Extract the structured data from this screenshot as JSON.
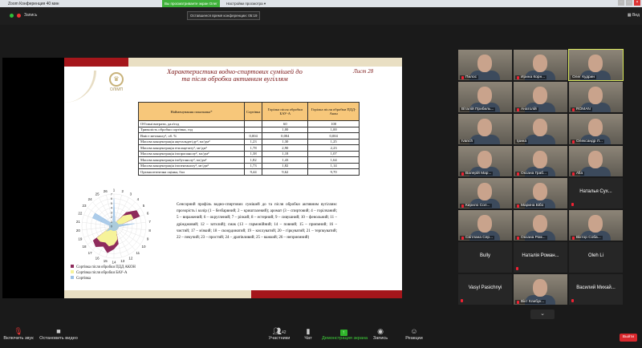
{
  "window": {
    "title": "Zoom Конференция 40 мин",
    "viewing_banner": "Вы просматриваете экран Олег Кудрин",
    "view_options": "Настройки просмотра ▾"
  },
  "meeting_bar": {
    "recording": "Запись",
    "timer": "Оставшееся время конференции: 05:19",
    "view": "Вид"
  },
  "slide": {
    "title_line1": "Характеристика водно-спиртових сумішей до",
    "title_line2": "та після обробки активним вугіллям",
    "sheet": "Лист 28",
    "logo_text": "ОЛІМП",
    "table": {
      "headers": [
        "Найменування показника*",
        "Сортівка",
        "Горілка після обробки БАУ-А",
        "Горілка після обробки ПДД-Акон"
      ],
      "rows": [
        [
          "Об'ємні витрати, дал/год",
          "",
          "60",
          "100"
        ],
        [
          "Тривалість обробки сортівки, год",
          "",
          "1,00",
          "1,00"
        ],
        [
          "Вміст метанолу¹, об. %",
          "0,004",
          "0,004",
          "0,004"
        ],
        [
          "Масова концентрація ацетальдегіду², мг/дм³",
          "1,23",
          "1,30",
          "1,25"
        ],
        [
          "Масова концентрація етилацетату², мг/дм³",
          "1,78",
          "2,90",
          "2,23"
        ],
        [
          "Масова концентрація ізопропанолу², мг/дм³",
          "1,38",
          "1,18",
          "1,07"
        ],
        [
          "Масова концентрація ізобутанолу², мг/дм³",
          "1,82",
          "1,43",
          "1,64"
        ],
        [
          "Масова концентрація ізопентанолу², мг/дм³",
          "1,73",
          "1,82",
          "1,14"
        ],
        [
          "Органолептична оцінка, бал",
          "9,44",
          "9,62",
          "9,70"
        ]
      ]
    },
    "description": "Сенсорний профіль водно-спиртових сумішей до та після обробки активним вугіллям: прозорість і колір (1 – безбарвний; 2 – кришталевий); аромат (3 – спиртовий; 4 – горілчаний; 5 – виражений; 6 – округлений; 7 – різкий; 8 – естерний; 9 – сивушний; 10 – фенольний; 11 – дріжджовий; 12 – затхлий); смак (13 – гармонійний; 14 – повний; 15 – приємний; 16 – чистий; 17 – м'який; 18 – скоординатий; 19 – кислуватий; 20 – гіркуватий; 21 – терпкуватий; 22 – пекучий; 23 – простий; 24 – дратівливий; 25 – важкий; 26 – неприємний)",
    "radar": {
      "axes": [
        "1",
        "2",
        "3",
        "4",
        "5",
        "6",
        "7",
        "8",
        "9",
        "10",
        "11",
        "12",
        "13",
        "14",
        "15",
        "16",
        "17",
        "18",
        "19",
        "20",
        "21",
        "22",
        "23",
        "24",
        "25",
        "26"
      ],
      "scale_labels": [
        "0",
        "1",
        "2",
        "3",
        "4",
        "5",
        "6",
        "7"
      ],
      "max": 7,
      "series": [
        {
          "name": "Сортівка після обробки ПДД АКОН",
          "color": "#8e2b5c",
          "values": [
            1,
            1,
            1,
            4,
            6,
            6,
            1,
            1,
            1,
            1,
            1,
            1,
            4,
            5,
            6,
            5,
            6,
            5.5,
            1,
            1,
            1,
            1,
            1,
            1,
            1,
            1
          ]
        },
        {
          "name": "Сортівка після обробки БАУ-А",
          "color": "#f6f39a",
          "values": [
            1,
            1,
            1,
            3,
            4.5,
            4.5,
            1,
            1,
            1,
            1,
            1,
            1,
            3,
            4,
            4.5,
            4,
            4.5,
            4.5,
            1,
            1,
            1,
            1,
            1,
            1,
            1,
            1
          ]
        },
        {
          "name": "Сортівка",
          "color": "#9ec3e6",
          "values": [
            6,
            1,
            1,
            1,
            1,
            1,
            4.5,
            1,
            1,
            1,
            1,
            1,
            1,
            1,
            1,
            1,
            1,
            2,
            1,
            1,
            1,
            5,
            5,
            1,
            1,
            1
          ]
        }
      ]
    }
  },
  "participants": [
    {
      "name": "Пилос",
      "type": "video",
      "muted": true
    },
    {
      "name": "Ирина Корн...",
      "type": "video",
      "muted": true
    },
    {
      "name": "Олег Кудрин",
      "type": "video",
      "muted": false,
      "active": true
    },
    {
      "name": "Віталій Прибиль...",
      "type": "video",
      "muted": false
    },
    {
      "name": "Анатолій",
      "type": "video",
      "muted": true
    },
    {
      "name": "ROMAN",
      "type": "video",
      "muted": true
    },
    {
      "name": "Ivanch",
      "type": "video",
      "muted": false
    },
    {
      "name": "Ірина",
      "type": "video",
      "muted": false
    },
    {
      "name": "Олександр Л...",
      "type": "video",
      "muted": true
    },
    {
      "name": "Валерій Мар...",
      "type": "video",
      "muted": true
    },
    {
      "name": "Оксана Граб...",
      "type": "video",
      "muted": true
    },
    {
      "name": "Alla",
      "type": "video",
      "muted": true
    },
    {
      "name": "Кирило Сол...",
      "type": "video",
      "muted": true
    },
    {
      "name": "Марина Бібо",
      "type": "video",
      "muted": true
    },
    {
      "name": "Наталья Сух...",
      "type": "dark",
      "muted": true
    },
    {
      "name": "Світлана Сер...",
      "type": "video",
      "muted": true
    },
    {
      "name": "Оксана Ром...",
      "type": "video",
      "muted": true
    },
    {
      "name": "Віктор Соба...",
      "type": "video",
      "muted": true
    },
    {
      "name": "Bully",
      "type": "name",
      "muted": false
    },
    {
      "name": "Наталія Роман...",
      "type": "name",
      "muted": true
    },
    {
      "name": "Oleh Li",
      "type": "name",
      "muted": false
    },
    {
      "name": "Vasyl Pasichnyi",
      "type": "name",
      "muted": true
    },
    {
      "name": "Вікт Клибук...",
      "type": "video",
      "muted": true
    },
    {
      "name": "Василий Михай...",
      "type": "name",
      "muted": true
    }
  ],
  "toolbar": {
    "unmute": "Включить звук",
    "stop_video": "Остановить видео",
    "participants": "Участники",
    "participants_count": "42",
    "chat": "Чат",
    "share": "Демонстрация экрана",
    "record": "Запись",
    "reactions": "Реакции",
    "leave": "Выйти",
    "chevron": "⌄"
  }
}
